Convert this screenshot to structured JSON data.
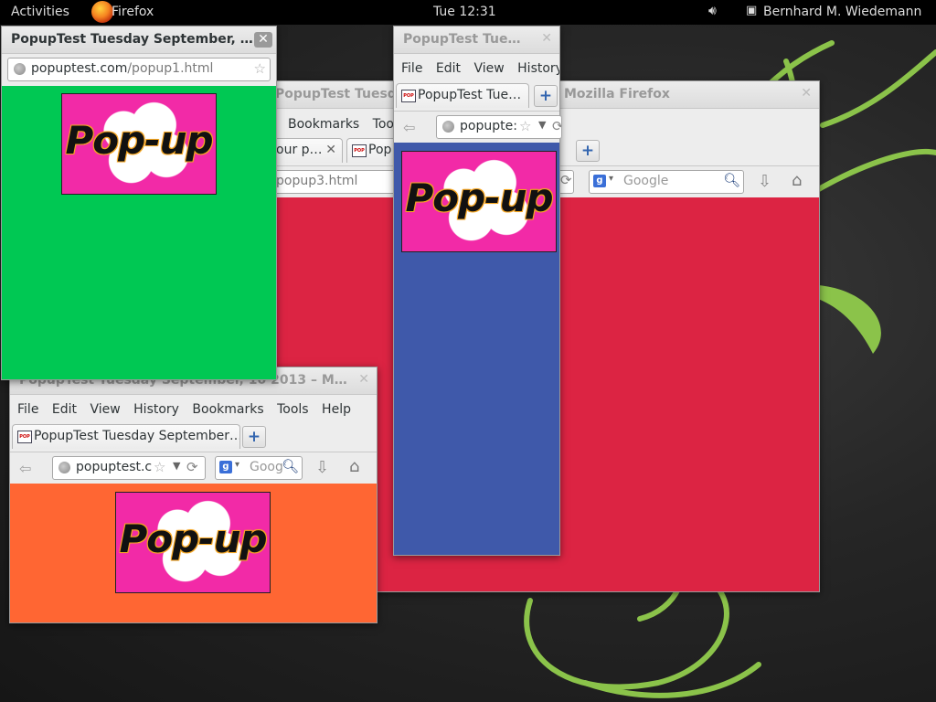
{
  "topbar": {
    "activities": "Activities",
    "app_name": "Firefox",
    "clock": "Tue 12:31",
    "user": "Bernhard M. Wiedemann"
  },
  "colors": {
    "main_bg": "#dc2443",
    "popup1_bg": "#00c853",
    "popup2_bg": "#3f59aa",
    "popup3_bg": "#ff6633",
    "pop_image_bg": "#f22aa7"
  },
  "pop_image_text": "Pop-up",
  "main_window": {
    "title": "PopupTest Tuesda",
    "title_suffix": "Mozilla Firefox",
    "menu": [
      "Bookmarks",
      "Too"
    ],
    "tab1_label": "our p…",
    "tab2_label": "Pop",
    "url_path": "popup3.html",
    "search_placeholder": "Google"
  },
  "popup1": {
    "title": "PopupTest Tuesday September, …",
    "url_host": "popuptest.com",
    "url_path": "/popup1.html"
  },
  "popup2": {
    "title": "PopupTest Tue…",
    "menu": [
      "File",
      "Edit",
      "View",
      "History"
    ],
    "tab_label": "PopupTest Tue…",
    "url": "popupte:"
  },
  "popup3": {
    "title": "PopupTest Tuesday September, 10 2013 – M…",
    "menu": [
      "File",
      "Edit",
      "View",
      "History",
      "Bookmarks",
      "Tools",
      "Help"
    ],
    "tab_label": "PopupTest Tuesday September…",
    "url": "popuptest.c",
    "search_placeholder": "Goog"
  }
}
